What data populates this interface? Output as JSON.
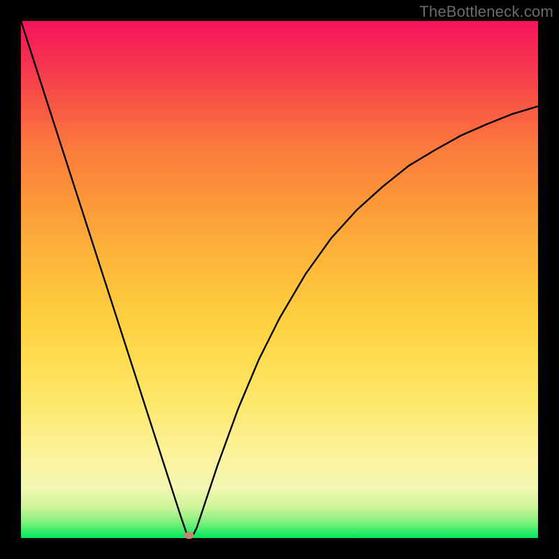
{
  "watermark": "TheBottleneck.com",
  "chart_data": {
    "type": "line",
    "title": "",
    "xlabel": "",
    "ylabel": "",
    "xlim": [
      0,
      1
    ],
    "ylim": [
      0,
      1
    ],
    "series": [
      {
        "name": "curve",
        "x": [
          0.0,
          0.05,
          0.1,
          0.15,
          0.2,
          0.25,
          0.29,
          0.31,
          0.32,
          0.33,
          0.34,
          0.36,
          0.38,
          0.42,
          0.46,
          0.5,
          0.55,
          0.6,
          0.65,
          0.7,
          0.75,
          0.8,
          0.85,
          0.9,
          0.95,
          1.0
        ],
        "y": [
          1.0,
          0.845,
          0.69,
          0.535,
          0.38,
          0.225,
          0.101,
          0.039,
          0.01,
          0.0,
          0.02,
          0.08,
          0.14,
          0.25,
          0.345,
          0.425,
          0.51,
          0.58,
          0.635,
          0.68,
          0.72,
          0.75,
          0.778,
          0.8,
          0.82,
          0.835
        ]
      }
    ],
    "marker": {
      "x": 0.325,
      "y": 0.005
    },
    "gradient_stops": [
      {
        "pos": 0.0,
        "color": "#00e65c"
      },
      {
        "pos": 0.1,
        "color": "#f4f7b2"
      },
      {
        "pos": 0.35,
        "color": "#fedc4e"
      },
      {
        "pos": 0.65,
        "color": "#fc983a"
      },
      {
        "pos": 1.0,
        "color": "#f5135b"
      }
    ]
  }
}
